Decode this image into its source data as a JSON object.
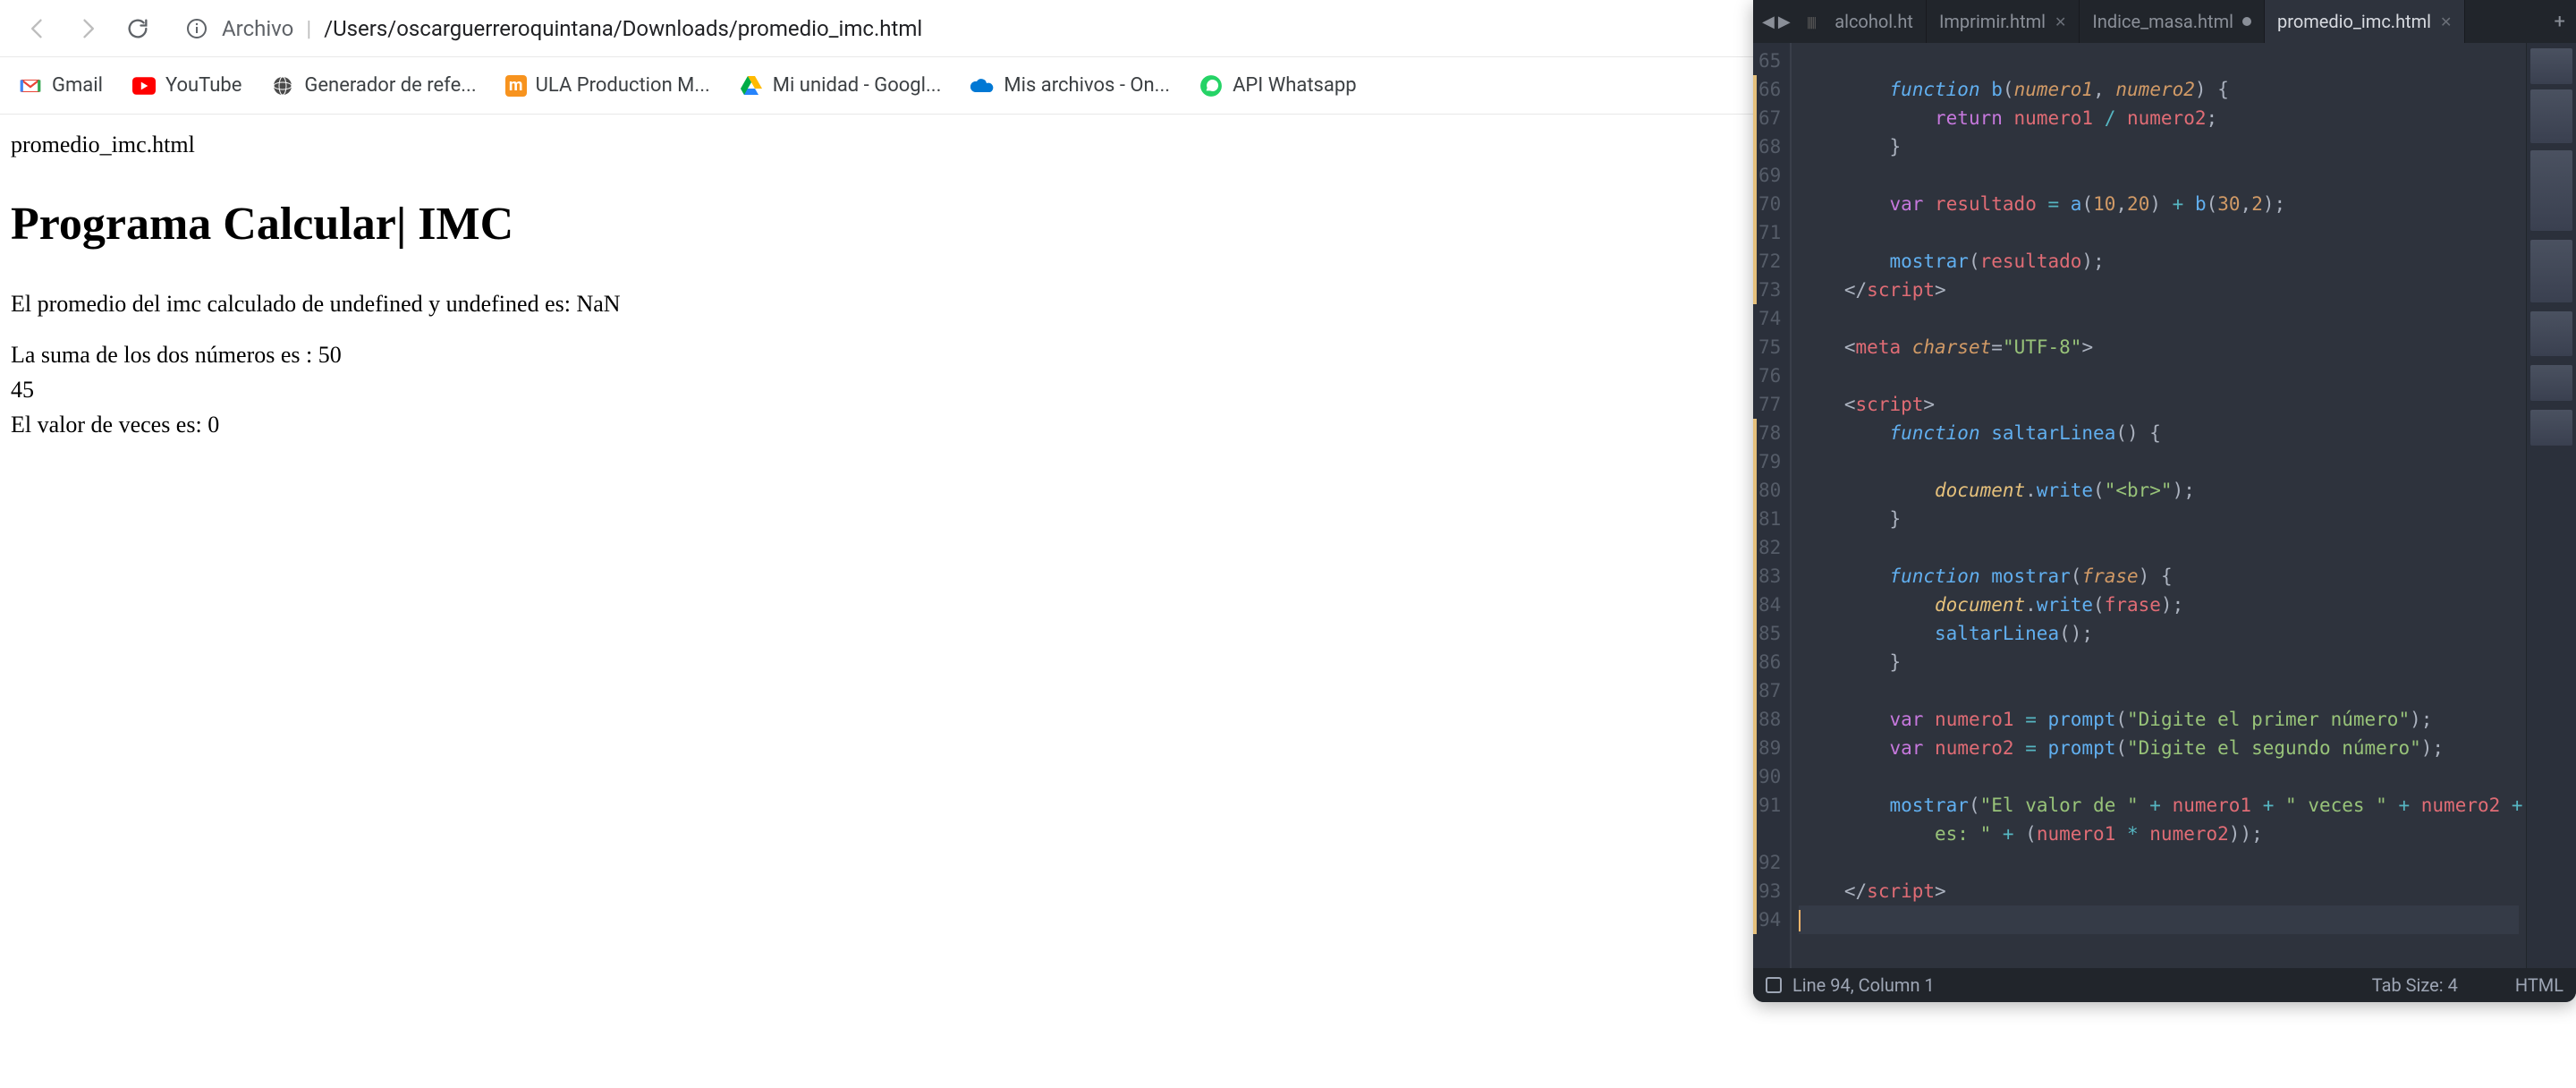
{
  "browser": {
    "address": {
      "label": "Archivo",
      "path": "/Users/oscarguerreroquintana/Downloads/promedio_imc.html"
    },
    "bookmarks": [
      {
        "label": "Gmail",
        "icon": "gmail"
      },
      {
        "label": "YouTube",
        "icon": "youtube"
      },
      {
        "label": "Generador de refe...",
        "icon": "globe"
      },
      {
        "label": "ULA Production M...",
        "icon": "ula"
      },
      {
        "label": "Mi unidad - Googl...",
        "icon": "gdrive"
      },
      {
        "label": "Mis archivos - On...",
        "icon": "onedrive"
      },
      {
        "label": "API Whatsapp",
        "icon": "whatsapp"
      }
    ],
    "page": {
      "filename": "promedio_imc.html",
      "heading": "Programa Calcular| IMC",
      "line1": "El promedio del imc calculado de undefined y undefined es: NaN",
      "line2": "La suma de los dos números es : 50",
      "line3": "45",
      "line4": "El valor de veces es: 0"
    }
  },
  "editor": {
    "tabs": [
      {
        "label": "alcohol.ht",
        "active": false,
        "close": false
      },
      {
        "label": "Imprimir.html",
        "active": false,
        "close": true
      },
      {
        "label": "Indice_masa.html",
        "active": false,
        "dirty": true
      },
      {
        "label": "promedio_imc.html",
        "active": true,
        "close": true
      }
    ],
    "gutter_start": 65,
    "gutter_lines": [
      "65",
      "66",
      "67",
      "68",
      "69",
      "70",
      "71",
      "72",
      "73",
      "74",
      "75",
      "76",
      "77",
      "78",
      "79",
      "80",
      "81",
      "82",
      "83",
      "84",
      "85",
      "86",
      "87",
      "88",
      "89",
      "90",
      "91",
      "",
      "92",
      "93",
      "94"
    ],
    "modified_lines": [
      66,
      67,
      68,
      69,
      70,
      71,
      72,
      73,
      78,
      79,
      80,
      81,
      82,
      83,
      84,
      85,
      86,
      87,
      88,
      89,
      90,
      91,
      92,
      93,
      94
    ],
    "code": {
      "l66a": "        ",
      "l66_fn": "function",
      "l66_sp": " ",
      "l66_name": "b",
      "l66_p": "(",
      "l66_a1": "numero1",
      "l66_c": ", ",
      "l66_a2": "numero2",
      "l66_pc": ") {",
      "l67a": "            ",
      "l67_ret": "return",
      "l67_sp": " ",
      "l67_v1": "numero1",
      "l67_op": " / ",
      "l67_v2": "numero2",
      "l67_sc": ";",
      "l68": "        }",
      "l70a": "        ",
      "l70_var": "var",
      "l70_sp": " ",
      "l70_name": "resultado",
      "l70_eq": " = ",
      "l70_f1": "a",
      "l70_p1": "(",
      "l70_n1": "10",
      "l70_c1": ",",
      "l70_n2": "20",
      "l70_pc1": ")",
      "l70_plus": " + ",
      "l70_f2": "b",
      "l70_p2": "(",
      "l70_n3": "30",
      "l70_c2": ",",
      "l70_n4": "2",
      "l70_pc2": ");",
      "l72a": "        ",
      "l72_fn": "mostrar",
      "l72_p": "(",
      "l72_v": "resultado",
      "l72_pc": ");",
      "l73a": "    ",
      "l73_o": "</",
      "l73_t": "script",
      "l73_c": ">",
      "l75a": "    ",
      "l75_o": "<",
      "l75_t": "meta",
      "l75_sp": " ",
      "l75_attr": "charset",
      "l75_eq": "=",
      "l75_v": "\"UTF-8\"",
      "l75_c": ">",
      "l77a": "    ",
      "l77_o": "<",
      "l77_t": "script",
      "l77_c": ">",
      "l78a": "        ",
      "l78_fn": "function",
      "l78_sp": " ",
      "l78_name": "saltarLinea",
      "l78_pc": "() {",
      "l80a": "            ",
      "l80_obj": "document",
      "l80_dot": ".",
      "l80_fn": "write",
      "l80_p": "(",
      "l80_s": "\"<br>\"",
      "l80_pc": ");",
      "l81": "        }",
      "l83a": "        ",
      "l83_fn": "function",
      "l83_sp": " ",
      "l83_name": "mostrar",
      "l83_p": "(",
      "l83_a": "frase",
      "l83_pc": ") {",
      "l84a": "            ",
      "l84_obj": "document",
      "l84_dot": ".",
      "l84_fn": "write",
      "l84_p": "(",
      "l84_v": "frase",
      "l84_pc": ");",
      "l85a": "            ",
      "l85_fn": "saltarLinea",
      "l85_pc": "();",
      "l86": "        }",
      "l88a": "        ",
      "l88_var": "var",
      "l88_sp": " ",
      "l88_name": "numero1",
      "l88_eq": " = ",
      "l88_fn": "prompt",
      "l88_p": "(",
      "l88_s": "\"Digite el primer número\"",
      "l88_pc": ");",
      "l89a": "        ",
      "l89_var": "var",
      "l89_sp": " ",
      "l89_name": "numero2",
      "l89_eq": " = ",
      "l89_fn": "prompt",
      "l89_p": "(",
      "l89_s": "\"Digite el segundo número\"",
      "l89_pc": ");",
      "l91a": "        ",
      "l91_fn": "mostrar",
      "l91_p": "(",
      "l91_s1": "\"El valor de \"",
      "l91_plus1": " + ",
      "l91_v1": "numero1",
      "l91_plus2": " + ",
      "l91_s2": "\" veces \"",
      "l91_plus3": " + ",
      "l91_v2": "numero2",
      "l91_plus4": " + ",
      "l91_s3": "\"",
      "l91b_a": "            ",
      "l91b_s": "es: \"",
      "l91b_plus": " + ",
      "l91b_p": "(",
      "l91b_v1": "numero1",
      "l91b_op": " * ",
      "l91b_v2": "numero2",
      "l91b_pc": "));",
      "l93a": "    ",
      "l93_o": "</",
      "l93_t": "script",
      "l93_c": ">"
    },
    "status": {
      "position": "Line 94, Column 1",
      "tabsize": "Tab Size: 4",
      "lang": "HTML"
    }
  }
}
